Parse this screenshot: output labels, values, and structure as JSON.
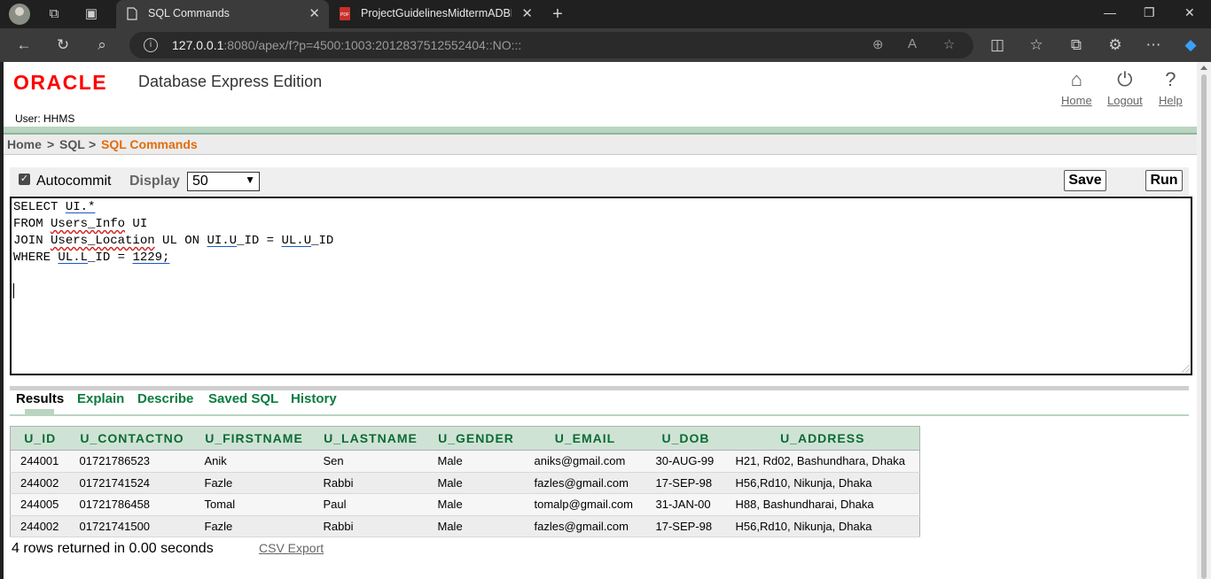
{
  "browser": {
    "tabs": [
      {
        "title": "SQL Commands",
        "active": true,
        "icon": "page-icon"
      },
      {
        "title": "ProjectGuidelinesMidtermADBMS",
        "active": false,
        "icon": "pdf-icon"
      }
    ],
    "url_host": "127.0.0.1",
    "url_rest": ":8080/apex/f?p=4500:1003:2012837512552404::NO:::"
  },
  "header": {
    "logo": "ORACLE",
    "edition": "Database Express Edition",
    "user": "User: HHMS",
    "links": [
      "Home",
      "Logout",
      "Help"
    ]
  },
  "breadcrumb": {
    "home": "Home",
    "sep": ">",
    "sql": "SQL",
    "current": "SQL Commands"
  },
  "toolbar": {
    "autocommit_label": "Autocommit",
    "autocommit_checked": true,
    "display_label": "Display",
    "display_value": "50",
    "save_label": "Save",
    "run_label": "Run"
  },
  "editor": {
    "lines": [
      "SELECT UI.*",
      "FROM Users_Info UI",
      "JOIN Users_Location UL ON UI.U_ID = UL.U_ID",
      "WHERE UL.L_ID = 1229;"
    ]
  },
  "result_tabs": [
    "Results",
    "Explain",
    "Describe",
    "Saved SQL",
    "History"
  ],
  "results": {
    "columns": [
      "U_ID",
      "U_CONTACTNO",
      "U_FIRSTNAME",
      "U_LASTNAME",
      "U_GENDER",
      "U_EMAIL",
      "U_DOB",
      "U_ADDRESS"
    ],
    "rows": [
      [
        "244001",
        "01721786523",
        "Anik",
        "Sen",
        "Male",
        "aniks@gmail.com",
        "30-AUG-99",
        "H21, Rd02, Bashundhara, Dhaka"
      ],
      [
        "244002",
        "01721741524",
        "Fazle",
        "Rabbi",
        "Male",
        "fazles@gmail.com",
        "17-SEP-98",
        "H56,Rd10, Nikunja, Dhaka"
      ],
      [
        "244005",
        "01721786458",
        "Tomal",
        "Paul",
        "Male",
        "tomalp@gmail.com",
        "31-JAN-00",
        "H88, Bashundharai, Dhaka"
      ],
      [
        "244002",
        "01721741500",
        "Fazle",
        "Rabbi",
        "Male",
        "fazles@gmail.com",
        "17-SEP-98",
        "H56,Rd10, Nikunja, Dhaka"
      ]
    ],
    "summary": "4 rows returned in 0.00 seconds",
    "csv_label": "CSV Export"
  },
  "colors": {
    "accent_green": "#0b7c3e",
    "header_green": "#cfe3d5",
    "oracle_red": "#ff0000",
    "breadcrumb_current": "#e36c0a"
  }
}
